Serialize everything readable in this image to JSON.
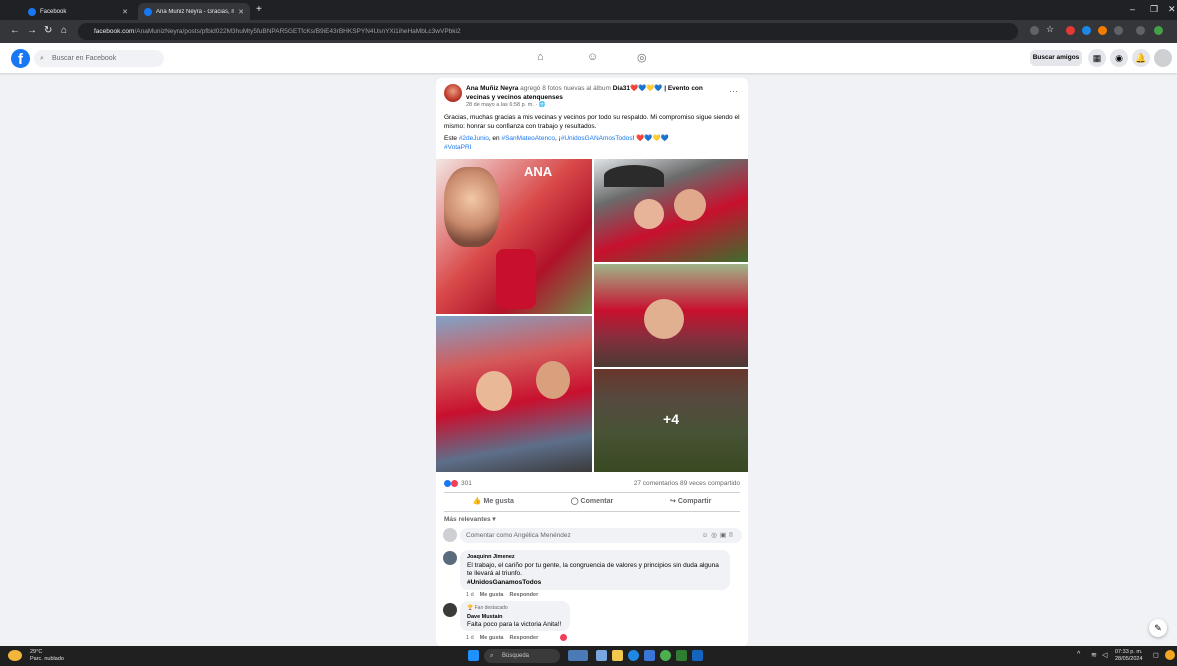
{
  "browser": {
    "tabs": [
      {
        "title": "Facebook"
      },
      {
        "title": "Ana Muñiz Neyra - Gracias, m..."
      }
    ],
    "url_domain": "facebook.com",
    "url_path": "/AnaMunizNeyra/posts/pfbid022M3huMty5fuBNPAR5GETfcKs/B9iE43rBHKSPYN4UsnYXi1iheHaMbLc3wVPbki2"
  },
  "fb": {
    "search_placeholder": "Buscar en Facebook",
    "find_friends": "Buscar amigos"
  },
  "post": {
    "author": "Ana Muñiz Neyra",
    "action": " agregó 8 fotos nuevas al álbum ",
    "album": "Día31❤️💙💛💙 | Evento con vecinas y vecinos atenquenses",
    "date": "28 de mayo a las 6:58 p. m. · 🌐",
    "text1": "Gracias, muchas gracias a mis vecinas y vecinos por todo su respaldo. Mi compromiso sigue siendo el mismo: honrar su confianza con trabajo y resultados.",
    "text2_pre": "Este ",
    "hashtag1": "#2deJunio",
    "text2_mid": ", en ",
    "hashtag2": "#SanMateoAtenco",
    "text2_mid2": ", ¡",
    "hashtag3": "#UnidosGANAmosTodos",
    "text2_end": "! ❤️💙💛💙",
    "hashtag4": "#VotaPRI",
    "more_photos": "+4",
    "reactions_count": "301",
    "comments_shares": "27 comentarios  89 veces compartido",
    "like": "Me gusta",
    "comment": "Comentar",
    "share": "Compartir",
    "most_relevant": "Más relevantes ▾",
    "comment_placeholder": "Comentar como Angélica Menéndez"
  },
  "comments": [
    {
      "author": "Joaquinn Jimenez",
      "text": "El trabajo, el cariño por tu gente, la congruencia de valores y principios sin duda alguna te llevará al triunfo.",
      "tag": "#UnidosGanamosTodos",
      "time": "1 d",
      "like": "Me gusta",
      "reply": "Responder"
    },
    {
      "badge": "🏆 Fan destacado",
      "author": "Dave Mustain",
      "text": "Falta poco para la victoria Anita!!",
      "time": "1 d",
      "like": "Me gusta",
      "reply": "Responder"
    }
  ],
  "taskbar": {
    "weather_temp": "29°C",
    "weather_desc": "Parc. nublado",
    "search": "Búsqueda",
    "time": "07:33 p. m.",
    "date": "28/05/2024"
  },
  "colors": {
    "fb_blue": "#1877f2",
    "pri_red": "#c8102e"
  }
}
